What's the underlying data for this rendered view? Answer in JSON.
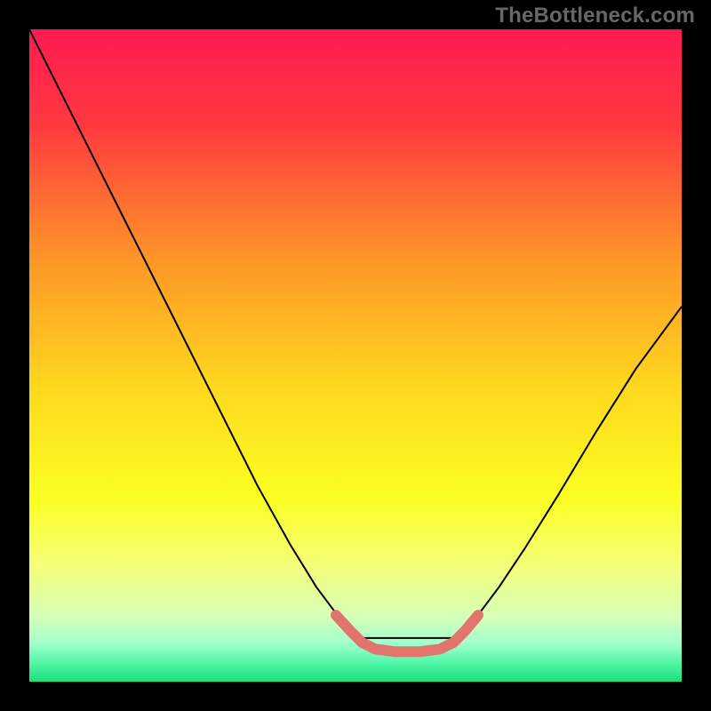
{
  "watermark": "TheBottleneck.com",
  "chart_data": {
    "type": "line",
    "title": "",
    "xlabel": "",
    "ylabel": "",
    "xlim": [
      0,
      1
    ],
    "ylim": [
      0,
      1
    ],
    "background": {
      "type": "vertical-gradient",
      "stops": [
        {
          "offset": 0.0,
          "color": "#ff1a52"
        },
        {
          "offset": 0.15,
          "color": "#ff3a3f"
        },
        {
          "offset": 0.35,
          "color": "#fd9528"
        },
        {
          "offset": 0.55,
          "color": "#fed81e"
        },
        {
          "offset": 0.72,
          "color": "#fbff23"
        },
        {
          "offset": 0.82,
          "color": "#f5ff78"
        },
        {
          "offset": 0.9,
          "color": "#d6ffb8"
        },
        {
          "offset": 0.94,
          "color": "#a4ffce"
        },
        {
          "offset": 0.97,
          "color": "#55f7a8"
        },
        {
          "offset": 1.0,
          "color": "#18e07a"
        }
      ]
    },
    "series": [
      {
        "name": "curve",
        "stroke": "#000000",
        "stroke_width": 2,
        "points": [
          [
            0.0,
            1.0
          ],
          [
            0.06,
            0.88
          ],
          [
            0.12,
            0.76
          ],
          [
            0.18,
            0.64
          ],
          [
            0.24,
            0.52
          ],
          [
            0.3,
            0.4
          ],
          [
            0.35,
            0.3
          ],
          [
            0.4,
            0.21
          ],
          [
            0.44,
            0.145
          ],
          [
            0.47,
            0.105
          ],
          [
            0.49,
            0.08
          ],
          [
            0.505,
            0.067
          ],
          [
            0.655,
            0.067
          ],
          [
            0.67,
            0.08
          ],
          [
            0.69,
            0.105
          ],
          [
            0.72,
            0.145
          ],
          [
            0.76,
            0.205
          ],
          [
            0.81,
            0.285
          ],
          [
            0.87,
            0.385
          ],
          [
            0.93,
            0.48
          ],
          [
            1.0,
            0.575
          ]
        ]
      },
      {
        "name": "bottom-highlight",
        "stroke": "#e2746e",
        "stroke_width": 12,
        "linecap": "round",
        "points": [
          [
            0.47,
            0.102
          ],
          [
            0.492,
            0.078
          ],
          [
            0.51,
            0.06
          ],
          [
            0.53,
            0.05
          ],
          [
            0.56,
            0.046
          ],
          [
            0.6,
            0.046
          ],
          [
            0.63,
            0.05
          ],
          [
            0.65,
            0.06
          ],
          [
            0.668,
            0.078
          ],
          [
            0.688,
            0.102
          ]
        ]
      }
    ]
  },
  "colors": {
    "background_frame": "#000000",
    "watermark": "#676767"
  }
}
